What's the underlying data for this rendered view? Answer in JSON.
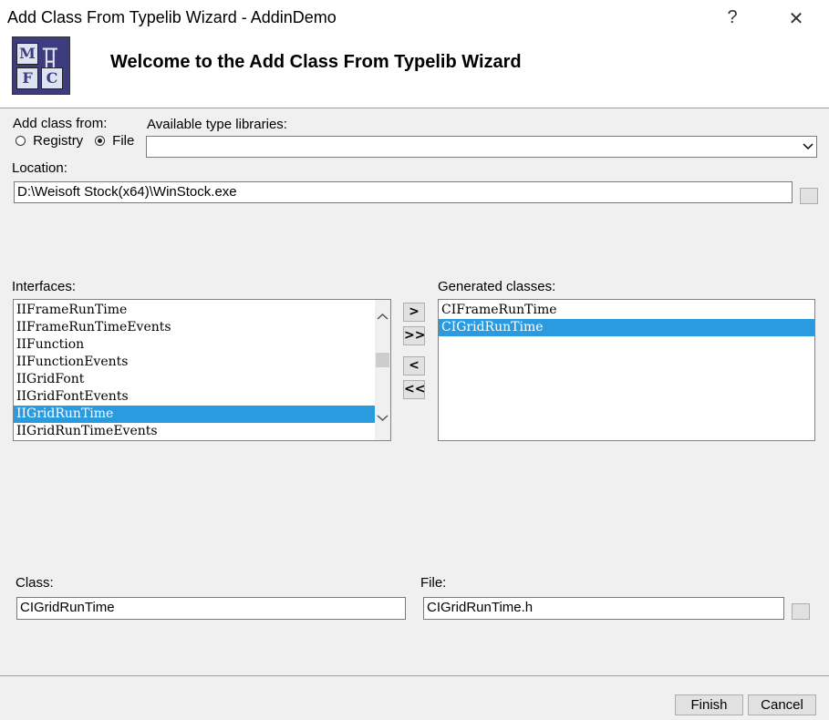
{
  "window": {
    "title": "Add Class From Typelib Wizard - AddinDemo",
    "help_glyph": "?",
    "close_glyph": "✕"
  },
  "header": {
    "welcome": "Welcome to the Add Class From Typelib Wizard",
    "logo_letters": [
      "M",
      "F",
      "C"
    ],
    "logo_icon": "mfc-logo-icon"
  },
  "source": {
    "label": "Add class from:",
    "registry_label": "Registry",
    "file_label": "File",
    "selected": "File"
  },
  "typelib": {
    "label": "Available type libraries:",
    "value": ""
  },
  "location": {
    "label": "Location:",
    "value": "D:\\Weisoft Stock(x64)\\WinStock.exe"
  },
  "interfaces": {
    "label": "Interfaces:",
    "items": [
      "IIFrameRunTime",
      "IIFrameRunTimeEvents",
      "IIFunction",
      "IIFunctionEvents",
      "IIGridFont",
      "IIGridFontEvents",
      "IIGridRunTime",
      "IIGridRunTimeEvents"
    ],
    "selected_index": 6
  },
  "move_buttons": {
    "add": ">",
    "add_all": ">>",
    "remove": "<",
    "remove_all": "<<"
  },
  "generated": {
    "label": "Generated classes:",
    "items": [
      "CIFrameRunTime",
      "CIGridRunTime"
    ],
    "selected_index": 1
  },
  "class": {
    "label": "Class:",
    "value": "CIGridRunTime"
  },
  "file": {
    "label": "File:",
    "value": "CIGridRunTime.h"
  },
  "buttons": {
    "finish": "Finish",
    "cancel": "Cancel"
  },
  "colors": {
    "selection": "#2b9be0",
    "background": "#f0f0f0"
  }
}
